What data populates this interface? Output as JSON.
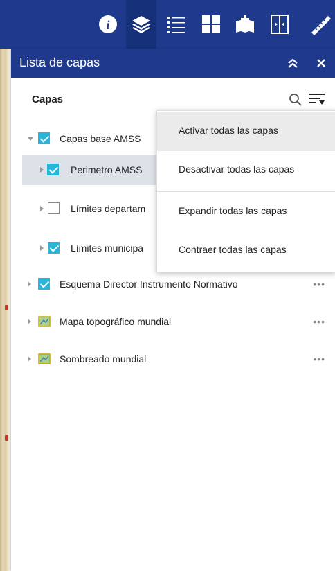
{
  "panel": {
    "title": "Lista de capas",
    "section_label": "Capas"
  },
  "layers": [
    {
      "label": "Capas base AMSS",
      "checked": true,
      "expanded": true
    },
    {
      "label": "Perimetro AMSS",
      "checked": true
    },
    {
      "label": "Límites departam",
      "checked": false
    },
    {
      "label": "Límites municipa",
      "checked": true
    },
    {
      "label": "Esquema Director Instrumento Normativo",
      "checked": true,
      "more": "•••"
    },
    {
      "label": "Mapa topográfico mundial",
      "more": "•••"
    },
    {
      "label": "Sombreado mundial",
      "more": "•••"
    }
  ],
  "menu": {
    "items": [
      "Activar todas las capas",
      "Desactivar todas las capas",
      "Expandir todas las capas",
      "Contraer todas las capas"
    ]
  },
  "colors": {
    "toolbar": "#1f3a8c",
    "check": "#2ab4d8"
  }
}
